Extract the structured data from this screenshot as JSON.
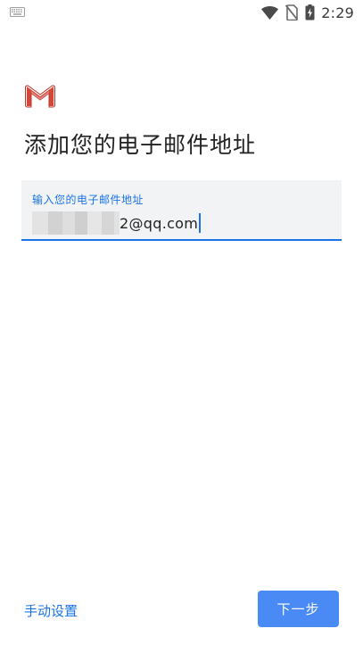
{
  "status_bar": {
    "time": "2:29",
    "icons": [
      "keyboard-icon",
      "wifi-icon",
      "no-sim-icon",
      "battery-charging-icon"
    ]
  },
  "app": {
    "logo": "gmail-logo",
    "title": "添加您的电子邮件地址"
  },
  "email_field": {
    "label": "输入您的电子邮件地址",
    "value_visible_suffix": "2@qq.com",
    "value_redacted": true
  },
  "footer": {
    "manual_setup_label": "手动设置",
    "next_label": "下一步"
  },
  "colors": {
    "accent": "#1a73e8",
    "button": "#4a8af4",
    "field_background": "#f1f3f4"
  }
}
